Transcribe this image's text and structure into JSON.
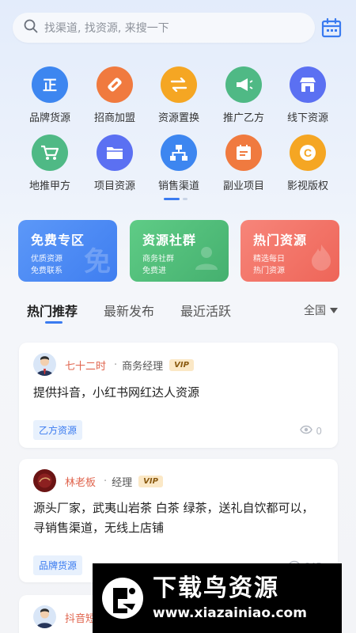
{
  "search": {
    "placeholder": "找渠道, 找资源, 来搜一下"
  },
  "grid": [
    {
      "label": "品牌货源",
      "glyph": "正",
      "color": "#3d86f0",
      "icon": "brand-source-icon"
    },
    {
      "label": "招商加盟",
      "glyph": "◆",
      "color": "#f07a3f",
      "icon": "handshake-icon"
    },
    {
      "label": "资源置换",
      "glyph": "⇄",
      "color": "#f5a623",
      "icon": "swap-icon"
    },
    {
      "label": "推广乙方",
      "glyph": "📢",
      "color": "#4fb985",
      "icon": "megaphone-icon"
    },
    {
      "label": "线下资源",
      "glyph": "▤",
      "color": "#5b70f2",
      "icon": "store-icon"
    },
    {
      "label": "地推甲方",
      "glyph": "🛒",
      "color": "#4fb985",
      "icon": "cart-icon"
    },
    {
      "label": "项目资源",
      "glyph": "▭",
      "color": "#5b70f2",
      "icon": "folder-icon"
    },
    {
      "label": "销售渠道",
      "glyph": "⊞",
      "color": "#3d86f0",
      "icon": "org-chart-icon"
    },
    {
      "label": "副业项目",
      "glyph": "▣",
      "color": "#f07a3f",
      "icon": "calendar-board-icon"
    },
    {
      "label": "影视版权",
      "glyph": "C",
      "color": "#f5a623",
      "icon": "copyright-icon"
    }
  ],
  "promos": [
    {
      "title": "免费专区",
      "line1": "优质资源",
      "line2": "免费联系",
      "deco": "免",
      "bg": "#4f8ef7"
    },
    {
      "title": "资源社群",
      "line1": "商务社群",
      "line2": "免费进",
      "deco": "👥",
      "bg": "#52bf7c"
    },
    {
      "title": "热门资源",
      "line1": "精选每日",
      "line2": "热门资源",
      "deco": "🔥",
      "bg": "#f4776b"
    }
  ],
  "tabs": [
    "热门推荐",
    "最新发布",
    "最近活跃"
  ],
  "region": "全国",
  "cards": [
    {
      "name": "七十二时",
      "role": "商务经理",
      "vip": "VIP",
      "content": "提供抖音，小红书网红达人资源",
      "tag": "乙方资源",
      "views": "0"
    },
    {
      "name": "林老板",
      "role": "经理",
      "vip": "VIP",
      "content": "源头厂家，武夷山岩茶 白茶 绿茶，送礼自饮都可以，寻销售渠道，无线上店铺",
      "tag": "品牌货源",
      "views": "645"
    },
    {
      "name": "抖音短"
    }
  ],
  "watermark": {
    "title": "下载鸟资源",
    "url": "www.xiazainiao.com"
  }
}
